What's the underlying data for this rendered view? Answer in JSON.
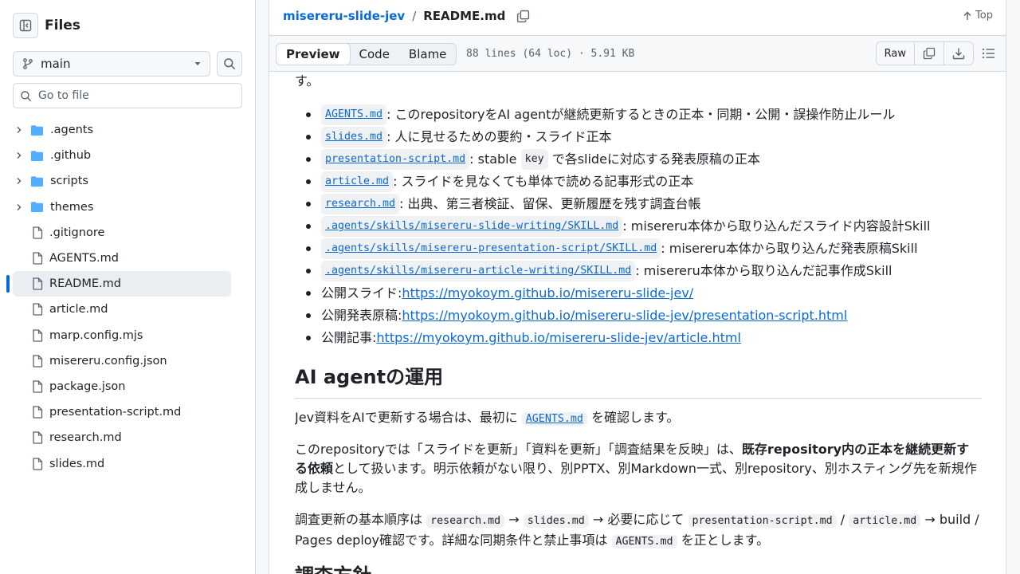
{
  "sidebar": {
    "title": "Files",
    "branch": "main",
    "goto_placeholder": "Go to file",
    "items": [
      {
        "name": ".agents",
        "type": "folder"
      },
      {
        "name": ".github",
        "type": "folder"
      },
      {
        "name": "scripts",
        "type": "folder"
      },
      {
        "name": "themes",
        "type": "folder"
      },
      {
        "name": ".gitignore",
        "type": "file"
      },
      {
        "name": "AGENTS.md",
        "type": "file"
      },
      {
        "name": "README.md",
        "type": "file",
        "selected": true
      },
      {
        "name": "article.md",
        "type": "file"
      },
      {
        "name": "marp.config.mjs",
        "type": "file"
      },
      {
        "name": "misereru.config.json",
        "type": "file"
      },
      {
        "name": "package.json",
        "type": "file"
      },
      {
        "name": "presentation-script.md",
        "type": "file"
      },
      {
        "name": "research.md",
        "type": "file"
      },
      {
        "name": "slides.md",
        "type": "file"
      }
    ]
  },
  "header": {
    "repo": "misereru-slide-jev",
    "separator": "/",
    "file": "README.md",
    "top_label": "Top"
  },
  "toolbar": {
    "tabs": [
      "Preview",
      "Code",
      "Blame"
    ],
    "active_tab": "Preview",
    "file_info": "88 lines (64 loc) · 5.91 KB",
    "raw_label": "Raw"
  },
  "content": {
    "fragment": "す。",
    "list": [
      {
        "code": "AGENTS.md",
        "text": ": このrepositoryをAI agentが継続更新するときの正本・同期・公開・誤操作防止ルール"
      },
      {
        "code": "slides.md",
        "text": ": 人に見せるための要約・スライド正本"
      },
      {
        "code": "presentation-script.md",
        "text": ": stable",
        "code2": "key",
        "text2": "で各slideに対応する発表原稿の正本"
      },
      {
        "code": "article.md",
        "text": ": スライドを見なくても単体で読める記事形式の正本"
      },
      {
        "code": "research.md",
        "text": ": 出典、第三者検証、留保、更新履歴を残す調査台帳"
      },
      {
        "code": ".agents/skills/misereru-slide-writing/SKILL.md",
        "text": ": misereru本体から取り込んだスライド内容設計Skill"
      },
      {
        "code": ".agents/skills/misereru-presentation-script/SKILL.md",
        "text": ": misereru本体から取り込んだ発表原稿Skill"
      },
      {
        "code": ".agents/skills/misereru-article-writing/SKILL.md",
        "text": ": misereru本体から取り込んだ記事作成Skill"
      },
      {
        "label": "公開スライド: ",
        "url": "https://myokoym.github.io/misereru-slide-jev/"
      },
      {
        "label": "公開発表原稿: ",
        "url": "https://myokoym.github.io/misereru-slide-jev/presentation-script.html"
      },
      {
        "label": "公開記事: ",
        "url": "https://myokoym.github.io/misereru-slide-jev/article.html"
      }
    ],
    "heading": "AI agentの運用",
    "p1": {
      "before": "Jev資料をAIで更新する場合は、最初に",
      "code": "AGENTS.md",
      "after": "を確認します。"
    },
    "p2": {
      "before": "このrepositoryでは「スライドを更新」「資料を更新」「調査結果を反映」は、",
      "bold": "既存repository内の正本を継続更新する依頼",
      "after": "として扱います。明示依頼がない限り、別PPTX、別Markdown一式、別repository、別ホスティング先を新規作成しません。"
    },
    "p3": {
      "t1": "調査更新の基本順序は",
      "c1": "research.md",
      "t2": "→",
      "c2": "slides.md",
      "t3": "→ 必要に応じて",
      "c3": "presentation-script.md",
      "t4": "/",
      "c4": "article.md",
      "t5": "→ build / Pages deploy確認です。詳細な同期条件と禁止事項は",
      "c5": "AGENTS.md",
      "t6": "を正とします。"
    },
    "next_heading": "調査方針"
  },
  "icons": {
    "sidebar_toggle": "sidebar-collapse-icon",
    "branch": "git-branch-icon",
    "search": "search-icon",
    "folder": "folder-icon",
    "file": "file-icon",
    "copy": "copy-icon",
    "download": "download-icon",
    "list": "list-icon",
    "arrow_up": "arrow-up-icon"
  },
  "colors": {
    "link": "#0969da",
    "folder": "#54aeff",
    "border": "#d1d9e0"
  }
}
